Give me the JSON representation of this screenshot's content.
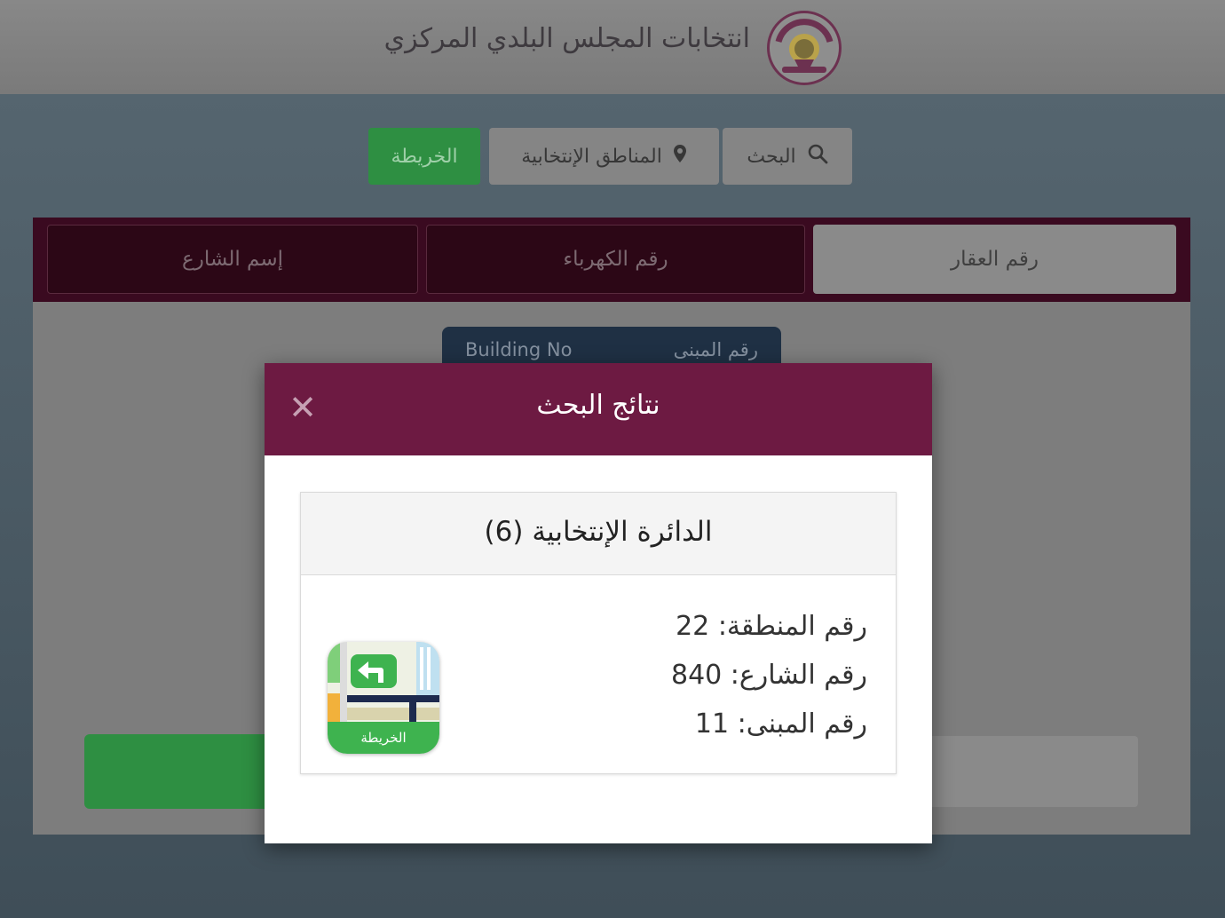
{
  "header": {
    "title": "انتخابات المجلس البلدي المركزي",
    "emblem_icon": "qatar-state-emblem"
  },
  "nav": {
    "map_label": "الخريطة",
    "regions_label": "المناطق الإنتخابية",
    "search_label": "البحث"
  },
  "tabs": {
    "street_name": "إسم الشارع",
    "electricity_no": "رقم الكهرباء",
    "property_no": "رقم العقار"
  },
  "form": {
    "building_label_en": "Building No",
    "building_label_ar": "رقم المبنى"
  },
  "modal": {
    "title": "نتائج البحث",
    "close_symbol": "✕",
    "district": "الدائرة الإنتخابية (6)",
    "zone_line": "رقم المنطقة: 22",
    "street_line": "رقم الشارع: 840",
    "building_line": "رقم المبنى: 11",
    "map_button_label": "الخريطة"
  },
  "colors": {
    "brand_maroon": "#6d1a42",
    "green": "#3eb34f",
    "overlay": "#55656f"
  }
}
